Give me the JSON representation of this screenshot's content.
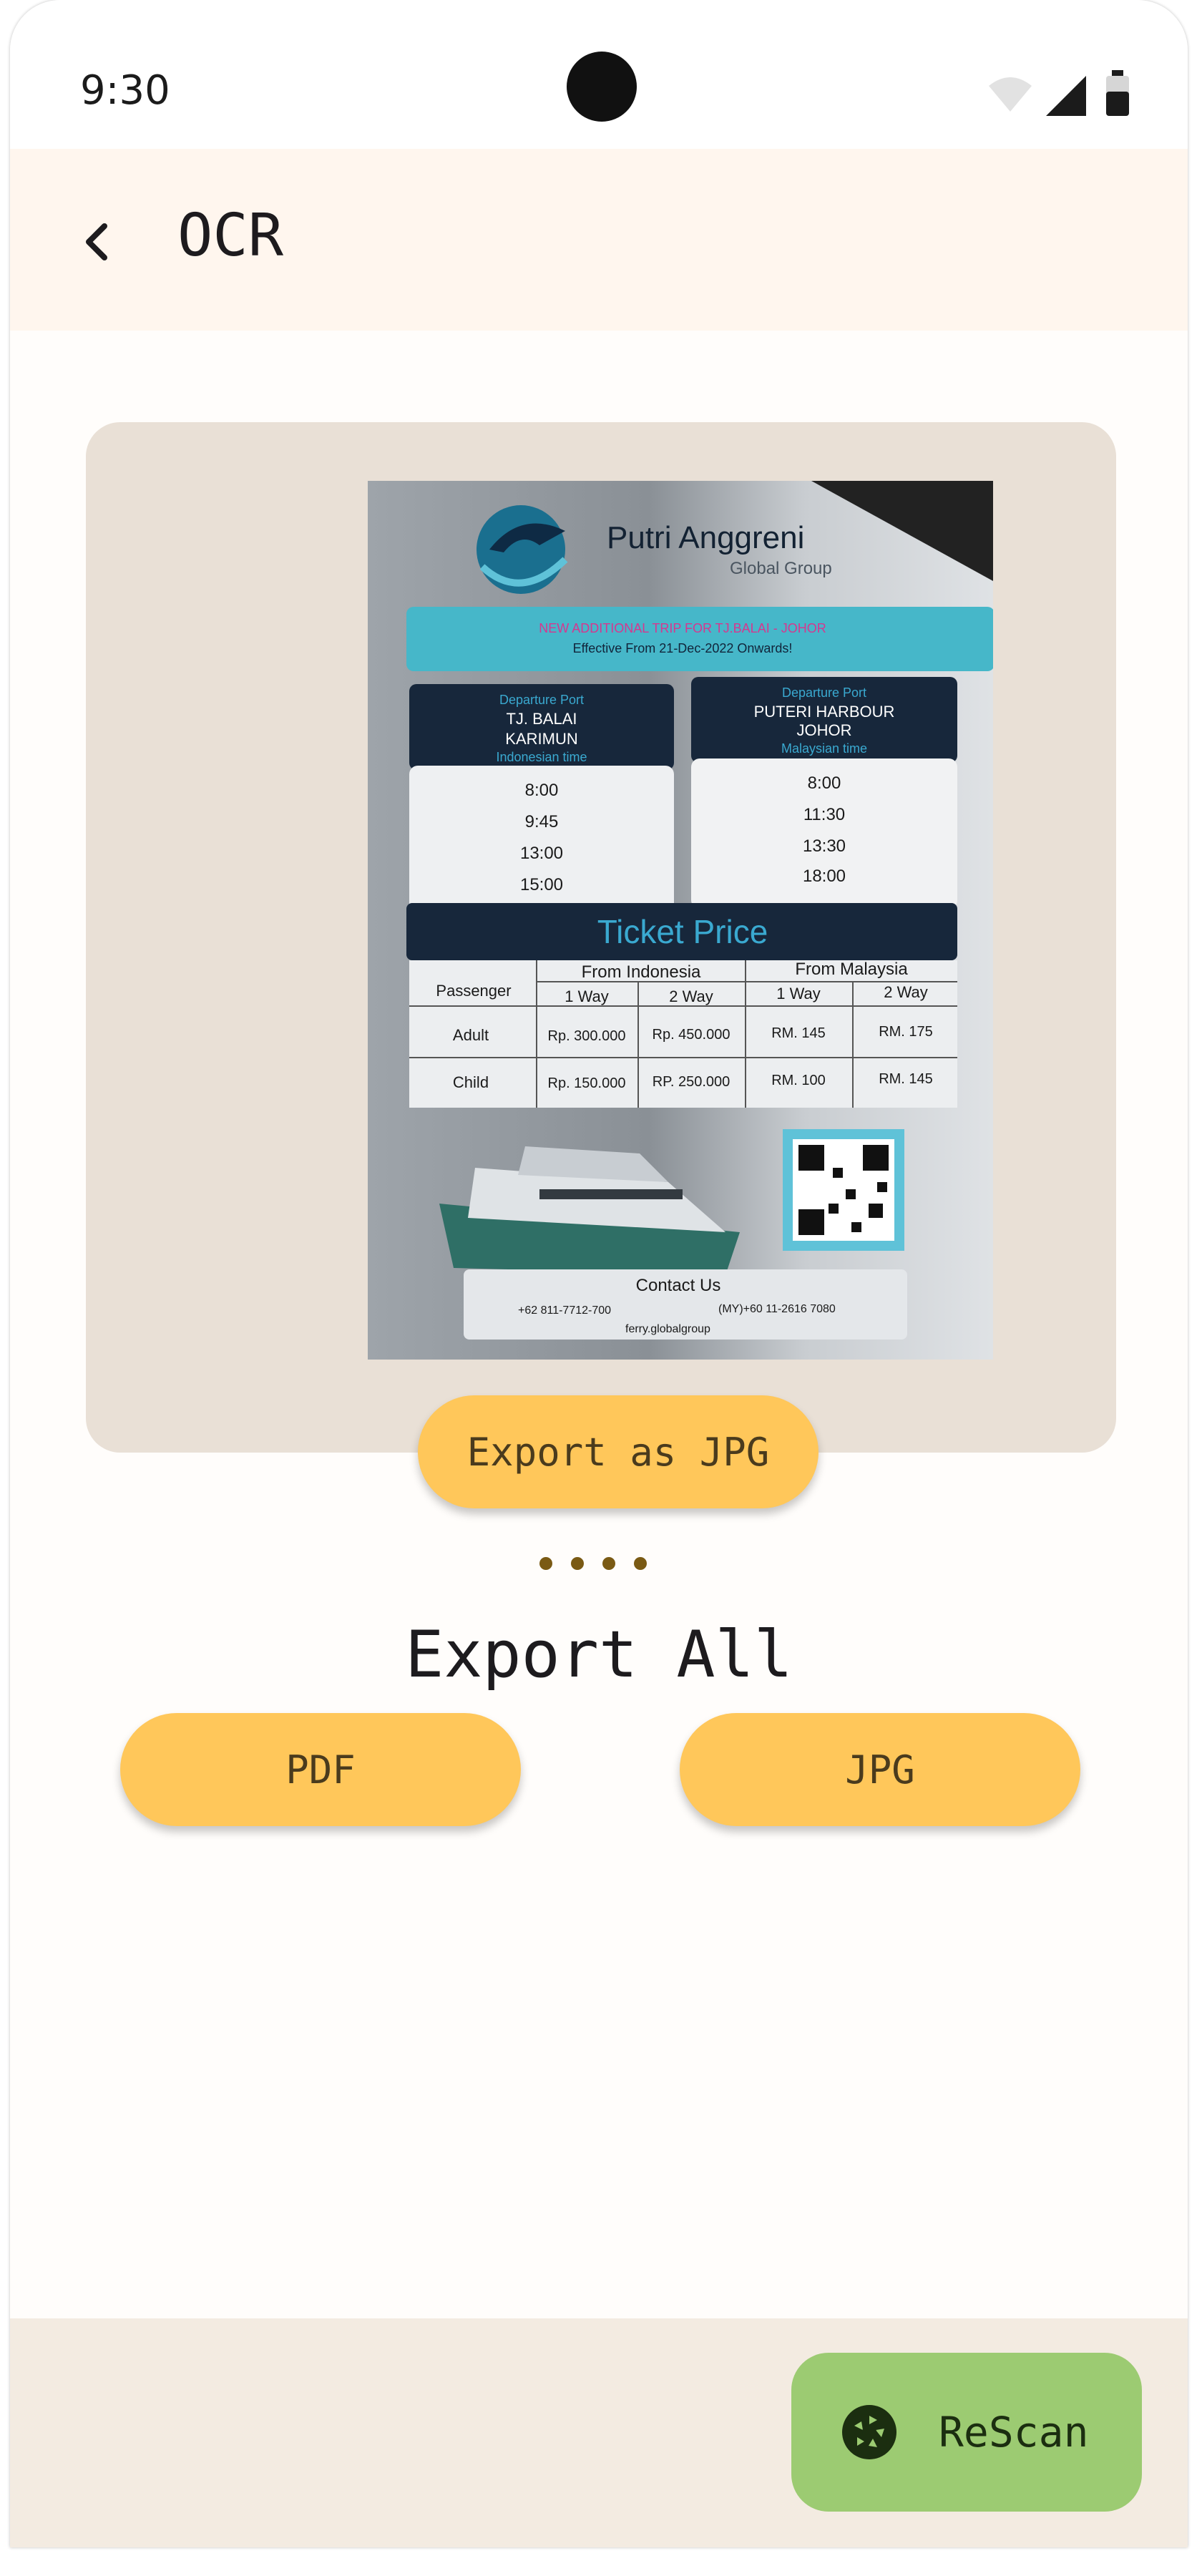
{
  "status_bar": {
    "time": "9:30"
  },
  "app_bar": {
    "title": "OCR",
    "back_icon": "chevron-left-icon"
  },
  "scanned_document": {
    "brand": "Putri Anggreni",
    "brand_sub": "Global Group",
    "banner_line1": "NEW ADDITIONAL TRIP FOR TJ.BALAI - JOHOR",
    "banner_line2": "Effective From 21-Dec-2022 Onwards!",
    "left_port": {
      "label": "Departure Port",
      "name_line1": "TJ. BALAI",
      "name_line2": "KARIMUN",
      "note": "Indonesian time",
      "times": [
        "8:00",
        "9:45",
        "13:00",
        "15:00"
      ]
    },
    "right_port": {
      "label": "Departure Port",
      "name_line1": "PUTERI HARBOUR",
      "name_line2": "JOHOR",
      "note": "Malaysian time",
      "times": [
        "8:00",
        "11:30",
        "13:30",
        "18:00"
      ]
    },
    "price_title": "Ticket Price",
    "price_head": {
      "passenger": "Passenger",
      "from_indonesia": "From Indonesia",
      "from_malaysia": "From Malaysia",
      "one_way": "1 Way",
      "two_way": "2 Way"
    },
    "price_rows": [
      {
        "label": "Adult",
        "idn_1": "Rp. 300.000",
        "idn_2": "Rp. 450.000",
        "my_1": "RM. 145",
        "my_2": "RM. 175"
      },
      {
        "label": "Child",
        "idn_1": "Rp. 150.000",
        "idn_2": "RP. 250.000",
        "my_1": "RM. 100",
        "my_2": "RM. 145"
      }
    ],
    "contact_title": "Contact Us",
    "phone_idn": "+62 811-7712-700",
    "phone_my": "(MY)+60 11-2616 7080",
    "social": "ferry.globalgroup"
  },
  "actions": {
    "export_jpg": "Export as JPG",
    "export_all_title": "Export All",
    "pdf": "PDF",
    "jpg": "JPG"
  },
  "bottom_bar": {
    "rescan_label": "ReScan",
    "rescan_icon": "camera-shutter-icon"
  },
  "colors": {
    "accent_button": "#ffc75a",
    "rescan_button": "#9ccb72",
    "app_bar_bg": "#fff6ee",
    "card_bg": "#e9e0d6"
  }
}
